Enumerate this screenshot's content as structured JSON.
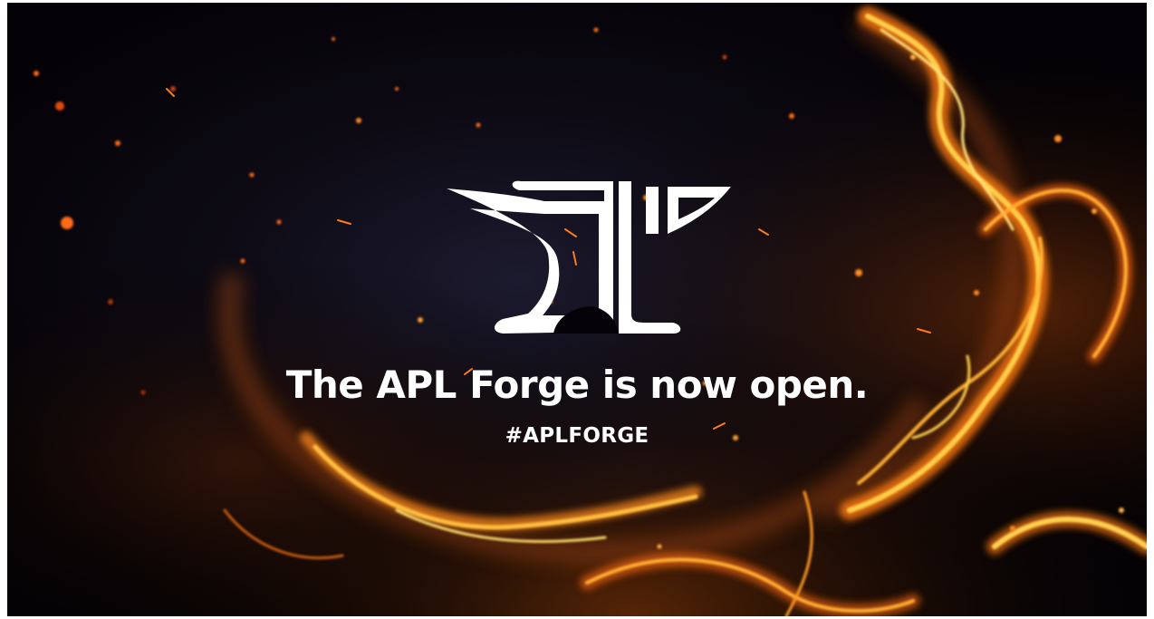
{
  "banner": {
    "headline": "The APL Forge is now open.",
    "hashtag": "#APLFORGE",
    "logo_icon": "anvil-logo-icon",
    "colors": {
      "background": "#050308",
      "fire_primary": "#ff8a1a",
      "fire_highlight": "#ffd04a",
      "text": "#ffffff"
    }
  }
}
